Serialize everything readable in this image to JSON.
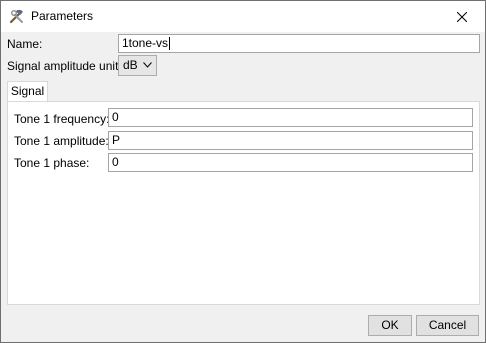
{
  "window": {
    "title": "Parameters",
    "icon": "hammer-wrench-icon"
  },
  "form": {
    "name_label": "Name:",
    "name_value": "1tone-vs",
    "units_label": "Signal amplitude units:",
    "units_value": "dB"
  },
  "tabs": [
    {
      "label": "Signal"
    }
  ],
  "signal": {
    "freq_label": "Tone 1 frequency:",
    "freq_value": "0",
    "amp_label": "Tone 1 amplitude:",
    "amp_value": "P",
    "phase_label": "Tone 1 phase:",
    "phase_value": "0"
  },
  "buttons": {
    "ok": "OK",
    "cancel": "Cancel"
  }
}
